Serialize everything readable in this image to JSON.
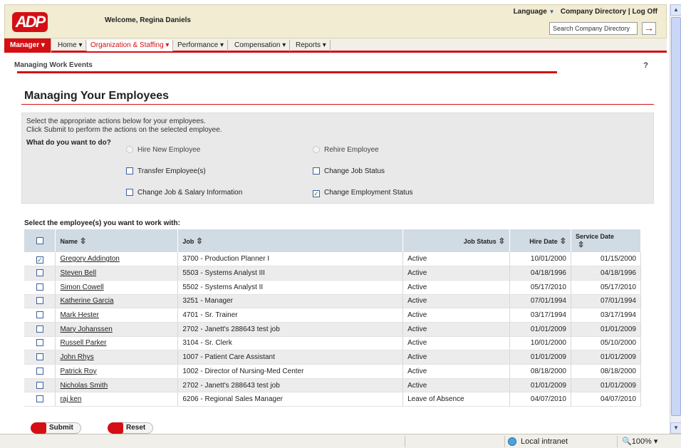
{
  "header": {
    "logo": "ADP",
    "welcome": "Welcome, Regina Daniels",
    "language": "Language",
    "company_directory": "Company Directory",
    "log_off": "Log Off",
    "search_placeholder": "Search Company Directory"
  },
  "nav": {
    "manager": "Manager ▾",
    "items": [
      "Home ▾",
      "Organization & Staffing ▾",
      "Performance ▾",
      "Compensation ▾",
      "Reports ▾"
    ]
  },
  "subheader": {
    "title": "Managing Work Events",
    "help": "?"
  },
  "page": {
    "title": "Managing Your Employees"
  },
  "actions": {
    "instruction1": "Select the appropriate actions below for your employees.",
    "instruction2": "Click Submit to perform the actions on the selected employee.",
    "question": "What do you want to do?",
    "hire_new": "Hire New Employee",
    "rehire": "Rehire Employee",
    "transfer": "Transfer Employee(s)",
    "change_job_status": "Change Job Status",
    "change_job_salary": "Change Job & Salary Information",
    "change_employment_status": "Change Employment Status"
  },
  "table": {
    "label": "Select the employee(s) you want to work with:",
    "headers": {
      "name": "Name",
      "job": "Job",
      "status": "Job Status",
      "hire": "Hire Date",
      "service": "Service Date"
    },
    "rows": [
      {
        "checked": true,
        "name": "Gregory Addington",
        "job": "3700 - Production Planner I",
        "status": "Active",
        "hire": "10/01/2000",
        "service": "01/15/2000"
      },
      {
        "checked": false,
        "name": "Steven Bell",
        "job": "5503 - Systems Analyst III",
        "status": "Active",
        "hire": "04/18/1996",
        "service": "04/18/1996"
      },
      {
        "checked": false,
        "name": "Simon Cowell",
        "job": "5502 - Systems Analyst II",
        "status": "Active",
        "hire": "05/17/2010",
        "service": "05/17/2010"
      },
      {
        "checked": false,
        "name": "Katherine Garcia",
        "job": "3251 - Manager",
        "status": "Active",
        "hire": "07/01/1994",
        "service": "07/01/1994"
      },
      {
        "checked": false,
        "name": "Mark Hester",
        "job": "4701 - Sr. Trainer",
        "status": "Active",
        "hire": "03/17/1994",
        "service": "03/17/1994"
      },
      {
        "checked": false,
        "name": "Mary Johanssen",
        "job": "2702 - Janett's 288643 test job",
        "status": "Active",
        "hire": "01/01/2009",
        "service": "01/01/2009"
      },
      {
        "checked": false,
        "name": "Russell Parker",
        "job": "3104 - Sr. Clerk",
        "status": "Active",
        "hire": "10/01/2000",
        "service": "05/10/2000"
      },
      {
        "checked": false,
        "name": "John Rhys",
        "job": "1007 - Patient Care Assistant",
        "status": "Active",
        "hire": "01/01/2009",
        "service": "01/01/2009"
      },
      {
        "checked": false,
        "name": "Patrick Roy",
        "job": "1002 - Director of Nursing-Med Center",
        "status": "Active",
        "hire": "08/18/2000",
        "service": "08/18/2000"
      },
      {
        "checked": false,
        "name": "Nicholas Smith",
        "job": "2702 - Janett's 288643 test job",
        "status": "Active",
        "hire": "01/01/2009",
        "service": "01/01/2009"
      },
      {
        "checked": false,
        "name": "raj ken",
        "job": "6206 - Regional Sales Manager",
        "status": "Leave of Absence",
        "hire": "04/07/2010",
        "service": "04/07/2010"
      }
    ]
  },
  "buttons": {
    "submit": "Submit",
    "reset": "Reset"
  },
  "statusbar": {
    "zone": "Local intranet",
    "zoom": "100%"
  }
}
